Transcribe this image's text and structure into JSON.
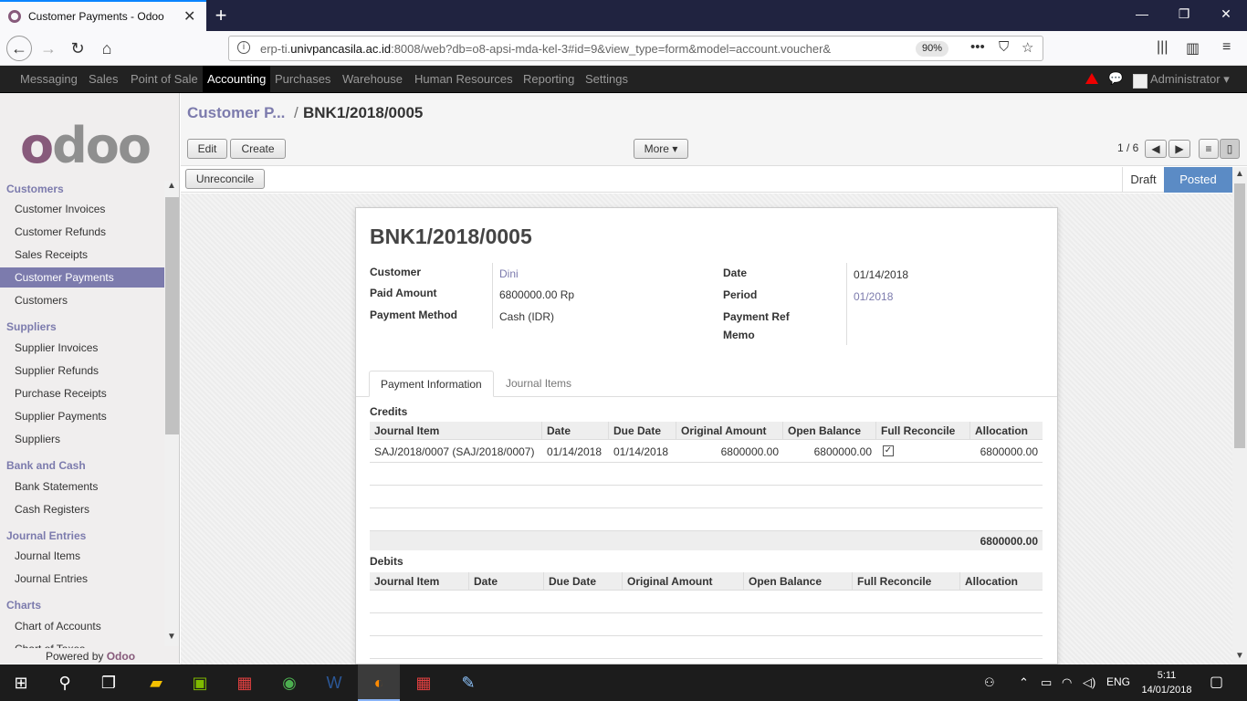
{
  "browser": {
    "tab_title": "Customer Payments - Odoo",
    "url_host": "erp-ti.",
    "url_domain": "univpancasila.ac.id",
    "url_rest": ":8008/web?db=o8-apsi-mda-kel-3#id=9&view_type=form&model=account.voucher&",
    "zoom": "90%"
  },
  "topmenu": {
    "items": [
      "Messaging",
      "Sales",
      "Point of Sale",
      "Accounting",
      "Purchases",
      "Warehouse",
      "Human Resources",
      "Reporting",
      "Settings"
    ],
    "active": "Accounting",
    "user": "Administrator"
  },
  "sidebar": {
    "sections": [
      {
        "title": "Customers",
        "items": [
          "Customer Invoices",
          "Customer Refunds",
          "Sales Receipts",
          "Customer Payments",
          "Customers"
        ]
      },
      {
        "title": "Suppliers",
        "items": [
          "Supplier Invoices",
          "Supplier Refunds",
          "Purchase Receipts",
          "Supplier Payments",
          "Suppliers"
        ]
      },
      {
        "title": "Bank and Cash",
        "items": [
          "Bank Statements",
          "Cash Registers"
        ]
      },
      {
        "title": "Journal Entries",
        "items": [
          "Journal Items",
          "Journal Entries"
        ]
      },
      {
        "title": "Charts",
        "items": [
          "Chart of Accounts",
          "Chart of Taxes"
        ]
      }
    ],
    "active_item": "Customer Payments",
    "powered_by": "Powered by",
    "powered_brand": "Odoo"
  },
  "control": {
    "breadcrumb_parent": "Customer P...",
    "breadcrumb_sep": "/",
    "breadcrumb_current": "BNK1/2018/0005",
    "edit_label": "Edit",
    "create_label": "Create",
    "more_label": "More ▾",
    "pager": "1 / 6",
    "unreconcile_label": "Unreconcile",
    "state_draft": "Draft",
    "state_posted": "Posted"
  },
  "form": {
    "name": "BNK1/2018/0005",
    "customer_label": "Customer",
    "customer_value": "Dini",
    "paid_amount_label": "Paid Amount",
    "paid_amount_value": "6800000.00 Rp",
    "payment_method_label": "Payment Method",
    "payment_method_value": "Cash (IDR)",
    "date_label": "Date",
    "date_value": "01/14/2018",
    "period_label": "Period",
    "period_value": "01/2018",
    "payment_ref_label": "Payment Ref",
    "memo_label": "Memo",
    "tab_payment_info": "Payment Information",
    "tab_journal_items": "Journal Items"
  },
  "credits": {
    "title": "Credits",
    "columns": [
      "Journal Item",
      "Date",
      "Due Date",
      "Original Amount",
      "Open Balance",
      "Full Reconcile",
      "Allocation"
    ],
    "rows": [
      {
        "journal_item": "SAJ/2018/0007 (SAJ/2018/0007)",
        "date": "01/14/2018",
        "due_date": "01/14/2018",
        "original_amount": "6800000.00",
        "open_balance": "6800000.00",
        "full_reconcile": true,
        "allocation": "6800000.00"
      }
    ],
    "total": "6800000.00"
  },
  "debits": {
    "title": "Debits",
    "columns": [
      "Journal Item",
      "Date",
      "Due Date",
      "Original Amount",
      "Open Balance",
      "Full Reconcile",
      "Allocation"
    ]
  },
  "taskbar": {
    "lang": "ENG",
    "time": "5:11",
    "date": "14/01/2018"
  }
}
